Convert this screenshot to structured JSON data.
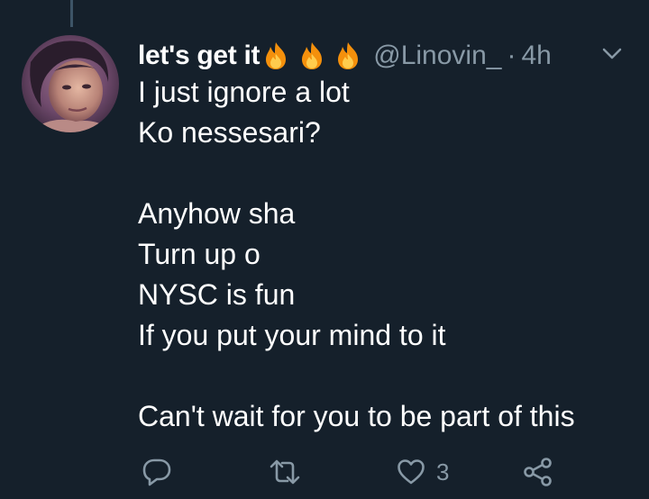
{
  "tweet": {
    "display_name": "let's get it",
    "name_emojis": [
      "fire-icon",
      "fire-icon",
      "fire-icon"
    ],
    "handle": "@Linovin_",
    "separator": "·",
    "time": "4h",
    "lines": [
      "I just ignore a lot",
      "Ko nessesari?",
      "",
      "Anyhow sha",
      "Turn up o",
      "NYSC is fun",
      "If you put your mind to it",
      "",
      "Can't wait for you to be part of this"
    ]
  },
  "actions": {
    "reply_icon": "reply-icon",
    "retweet_icon": "retweet-icon",
    "like_icon": "heart-icon",
    "like_count": "3",
    "share_icon": "share-icon"
  },
  "colors": {
    "background": "#15202b",
    "text": "#ffffff",
    "muted": "#8899a6",
    "thread_line": "#3d5466"
  }
}
